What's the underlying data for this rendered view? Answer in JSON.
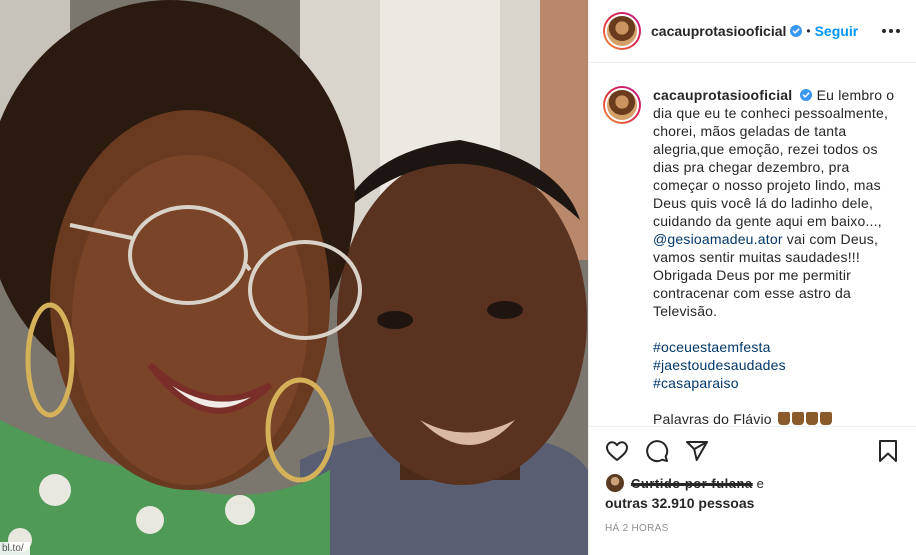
{
  "photo": {
    "alt_icon": "selfie-photo",
    "url_hint": "bl.to/"
  },
  "header": {
    "username": "cacauprotasiooficial",
    "verified_icon": "verified-badge-icon",
    "separator": "•",
    "follow_label": "Seguir",
    "more_icon": "more-options-icon"
  },
  "caption": {
    "username": "cacauprotasiooficial",
    "text_1": "Eu lembro o dia que eu te conheci pessoalmente, chorei, mãos geladas de tanta alegria,que emoção, rezei todos os dias pra chegar dezembro, pra começar o nosso projeto lindo, mas Deus quis você lá do ladinho dele, cuidando da gente aqui em baixo...,",
    "mention": "@gesioamadeu.ator",
    "text_2": "vai com Deus, vamos sentir muitas saudades!!! Obrigada Deus por me permitir contracenar com esse astro da Televisão.",
    "hashtags": [
      "#oceuestaemfesta",
      "#jaestoudesaudades",
      "#casaparaiso"
    ],
    "palavras": "Palavras do Flávio"
  },
  "actions": {
    "like_icon": "heart-icon",
    "comment_icon": "comment-icon",
    "share_icon": "share-icon",
    "save_icon": "bookmark-icon"
  },
  "likes": {
    "liked_by_redacted": "Curtido por fulana",
    "conjunction": "e",
    "others_label": "outras 32.910 pessoas"
  },
  "timestamp": "HÁ 2 HORAS",
  "colors": {
    "link": "#00376b",
    "follow": "#0095f6",
    "verified": "#3897f0",
    "timestamp": "#8e8e8e"
  }
}
